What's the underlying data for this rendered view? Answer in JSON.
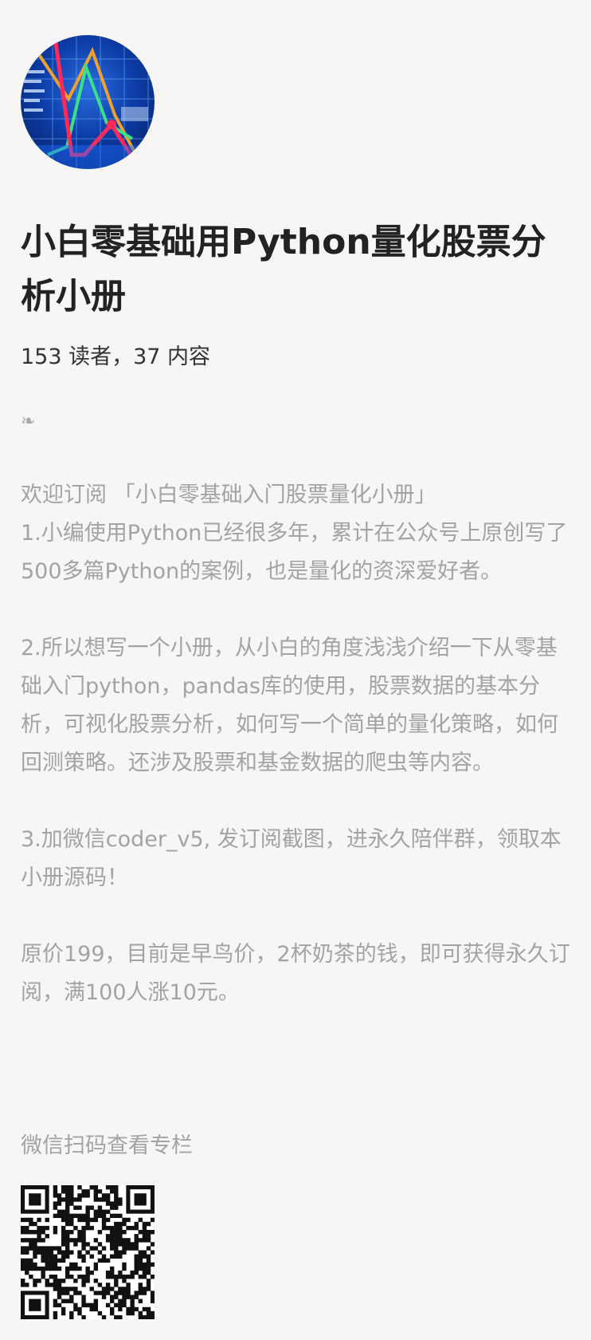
{
  "column": {
    "avatar_icon": "stock-chart-avatar-icon",
    "title": "小白零基础用Python量化股票分析小册",
    "stats": "153 读者，37 内容",
    "ornament": "❧"
  },
  "description": {
    "paragraphs": [
      "欢迎订阅 「小白零基础入门股票量化小册」\n1.小编使用Python已经很多年，累计在公众号上原创写了500多篇Python的案例，也是量化的资深爱好者。",
      "2.所以想写一个小册，从小白的角度浅浅介绍一下从零基础入门python，pandas库的使用，股票数据的基本分析，可视化股票分析，如何写一个简单的量化策略，如何回测策略。还涉及股票和基金数据的爬虫等内容。",
      "3.加微信coder_v5, 发订阅截图，进永久陪伴群，领取本小册源码！",
      "原价199，目前是早鸟价，2杯奶茶的钱，即可获得永久订阅，满100人涨10元。"
    ]
  },
  "qr": {
    "label": "微信扫码查看专栏",
    "icon": "qr-code-icon"
  },
  "colors": {
    "background": "#f7f6f5",
    "title": "#222222",
    "muted_text": "#a3a3a3"
  }
}
